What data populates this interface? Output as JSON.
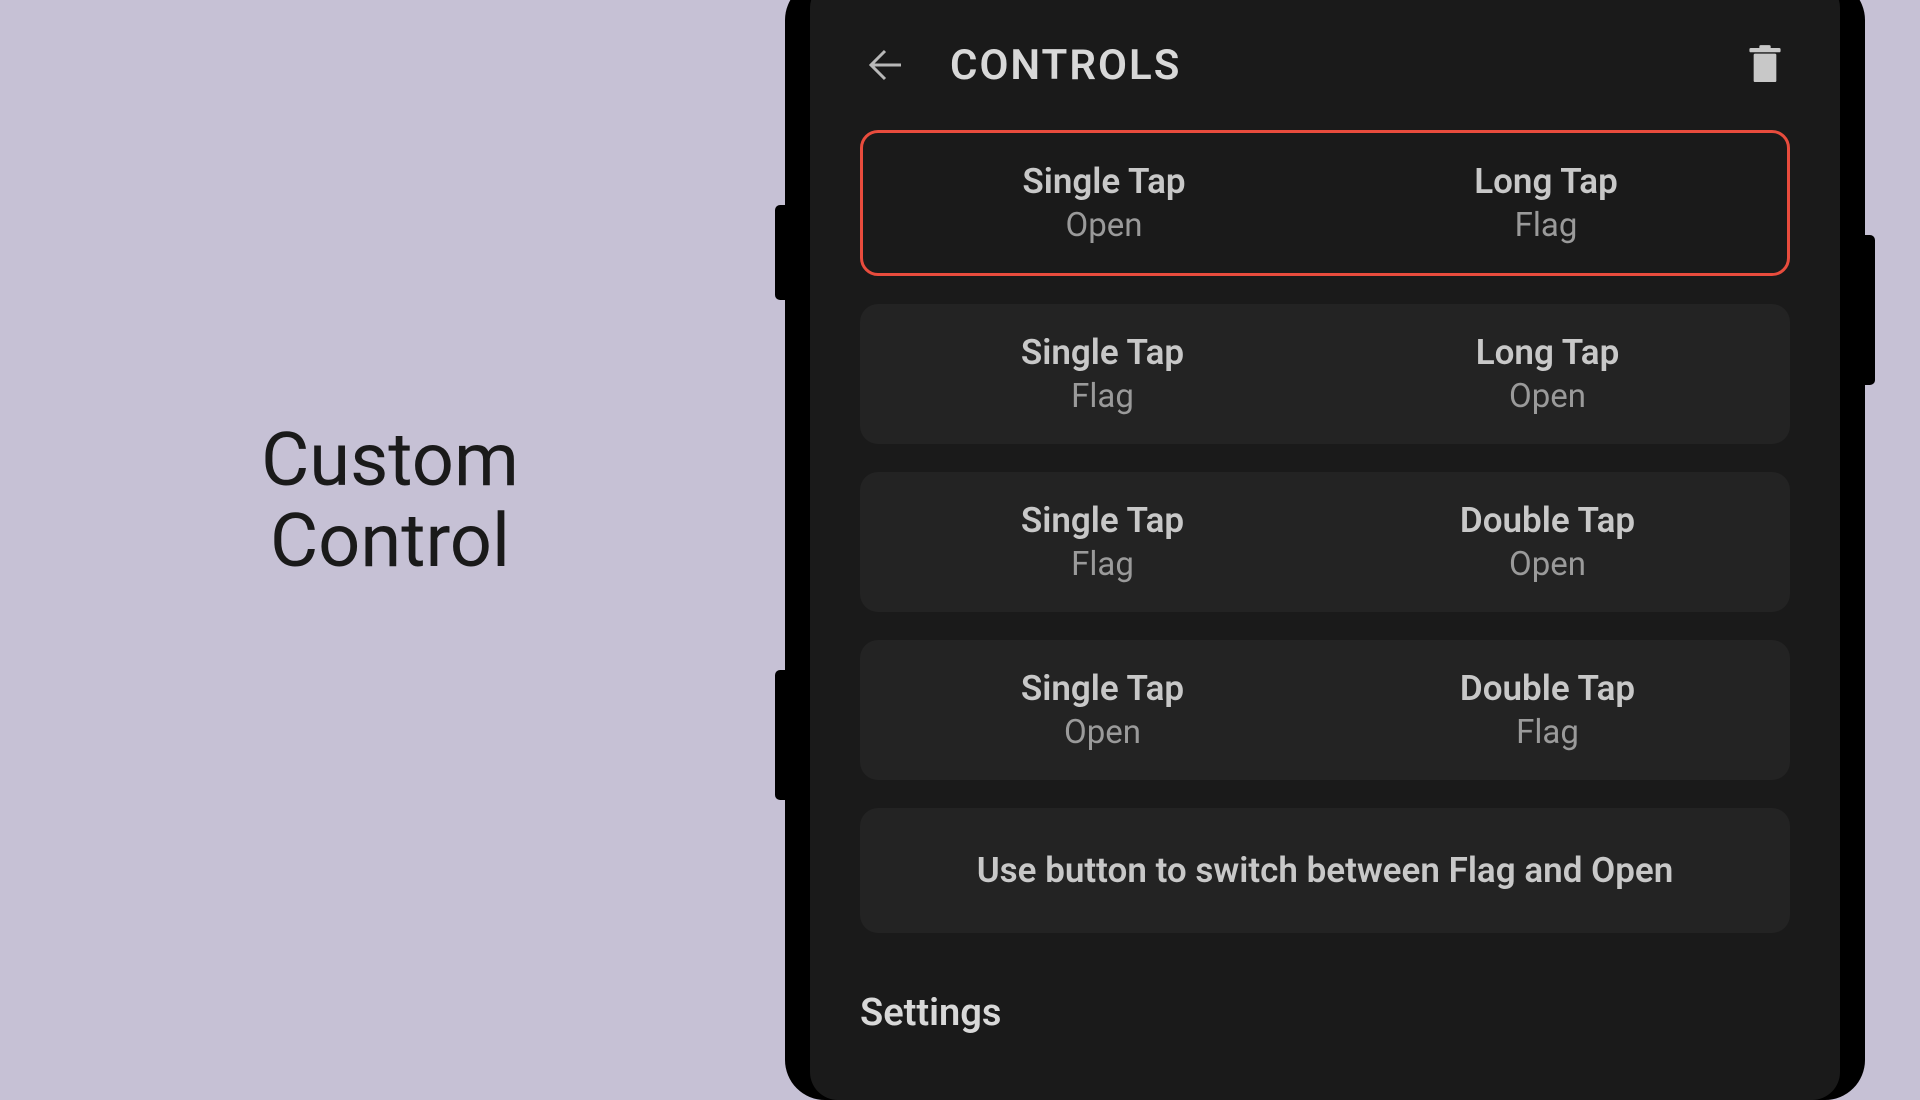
{
  "left": {
    "title_line1": "Custom",
    "title_line2": "Control"
  },
  "header": {
    "title": "CONTROLS"
  },
  "options": [
    {
      "selected": true,
      "left": {
        "label": "Single Tap",
        "value": "Open"
      },
      "right": {
        "label": "Long Tap",
        "value": "Flag"
      }
    },
    {
      "selected": false,
      "left": {
        "label": "Single Tap",
        "value": "Flag"
      },
      "right": {
        "label": "Long Tap",
        "value": "Open"
      }
    },
    {
      "selected": false,
      "left": {
        "label": "Single Tap",
        "value": "Flag"
      },
      "right": {
        "label": "Double Tap",
        "value": "Open"
      }
    },
    {
      "selected": false,
      "left": {
        "label": "Single Tap",
        "value": "Open"
      },
      "right": {
        "label": "Double Tap",
        "value": "Flag"
      }
    }
  ],
  "switch_option": {
    "text": "Use button to switch between Flag and Open"
  },
  "settings": {
    "title": "Settings"
  }
}
